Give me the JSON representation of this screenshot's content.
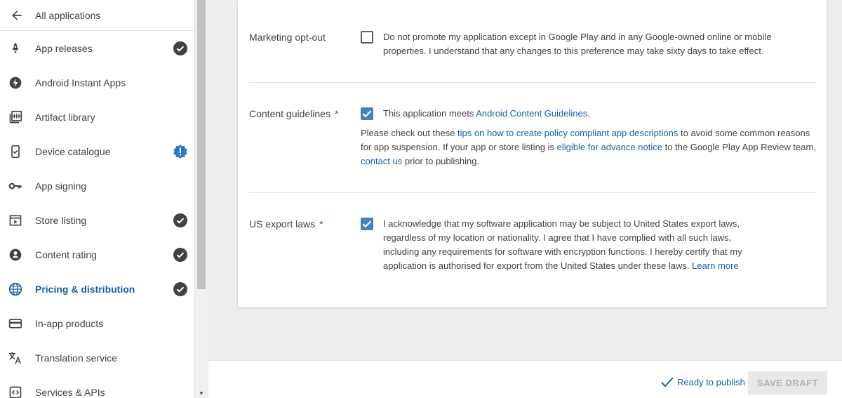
{
  "sidebar": {
    "back_label": "All applications",
    "items": [
      {
        "label": "App releases",
        "icon": "rocket-icon",
        "status": "complete"
      },
      {
        "label": "Android Instant Apps",
        "icon": "instant-bolt-icon",
        "status": ""
      },
      {
        "label": "Artifact library",
        "icon": "library-icon",
        "status": ""
      },
      {
        "label": "Device catalogue",
        "icon": "device-check-icon",
        "status": "warning"
      },
      {
        "label": "App signing",
        "icon": "key-icon",
        "status": ""
      },
      {
        "label": "Store listing",
        "icon": "store-icon",
        "status": "complete"
      },
      {
        "label": "Content rating",
        "icon": "rating-icon",
        "status": "complete"
      },
      {
        "label": "Pricing & distribution",
        "icon": "globe-icon",
        "status": "complete",
        "active": true
      },
      {
        "label": "In-app products",
        "icon": "card-icon",
        "status": ""
      },
      {
        "label": "Translation service",
        "icon": "translate-icon",
        "status": ""
      },
      {
        "label": "Services & APIs",
        "icon": "code-icon",
        "status": ""
      }
    ]
  },
  "marketing": {
    "label": "Marketing opt-out",
    "checked": false,
    "text_line1": "Do not promote my application except in Google Play and in any Google-owned online or mobile",
    "text_line2": "properties. I understand that any changes to this preference may take sixty days to take effect."
  },
  "content": {
    "label": "Content guidelines",
    "required_mark": "*",
    "checked": true,
    "check_text": "This application meets ",
    "check_link": "Android Content Guidelines",
    "check_end": ".",
    "p1": "Please check out these ",
    "link1": "tips on how to create policy compliant app descriptions",
    "p2": " to avoid some common reasons",
    "p3": "for app suspension. If your app or store listing is ",
    "link2": "eligible for advance notice",
    "p4": " to the Google Play App Review team,",
    "link3": "contact us",
    "p5": " prior to publishing."
  },
  "export": {
    "label": "US export laws",
    "required_mark": "*",
    "checked": true,
    "line1": "I acknowledge that my software application may be subject to United States export laws,",
    "line2": "regardless of my location or nationality. I agree that I have complied with all such laws,",
    "line3": "including any requirements for software with encryption functions. I hereby certify that my",
    "line4": "application is authorised for export from the United States under these laws. ",
    "link": "Learn more"
  },
  "footer": {
    "status": "Ready to publish",
    "save_label": "SAVE DRAFT"
  },
  "colors": {
    "accent": "#1a5fa6",
    "checkbox": "#4a7fbd",
    "status_dark": "#424242",
    "warning": "#2979c9"
  }
}
